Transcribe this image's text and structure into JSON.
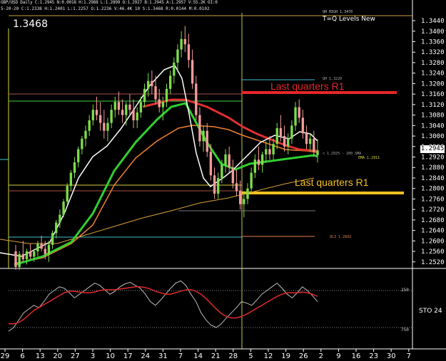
{
  "header": {
    "line1": "GBP/USD Daily  C:1.2945 N:0.0018 H:1.2988 L:1.2899 O:1.2927 B:1.2945 A:1.2957 V:55.2K OI:0",
    "line2": "5-20-20 C:1.2338 H:1.2401 L:1.2257 O:1.2236 V:46.4K 10 S:1.3468 R:0.0144 M:0.0102"
  },
  "big_price": "1.3468",
  "indicator_title": "T=Q Levels New",
  "indicator_small": "QH HIGH 1.3470",
  "level_labels": {
    "qh": "QH 1.3220",
    "ql": "QL3 1.2602",
    "sma": "< 1.2925 - 200 SMA",
    "ema": "EMA 1.2911"
  },
  "annotations": {
    "red": "Last quarters R1",
    "yellow": "Last quarters R1",
    "red_color": "#e8262b",
    "yellow_color": "#f5c022"
  },
  "current_price_tag": "1.2945",
  "price_axis": [
    "1.3440",
    "1.3400",
    "1.3360",
    "1.3320",
    "1.3280",
    "1.3240",
    "1.3200",
    "1.3160",
    "1.3120",
    "1.3080",
    "1.3040",
    "1.3000",
    "1.2960",
    "1.2920",
    "1.2880",
    "1.2840",
    "1.2800",
    "1.2760",
    "1.2720",
    "1.2680",
    "1.2640",
    "1.2600",
    "1.2560",
    "1.2520"
  ],
  "date_axis": [
    "29",
    "6",
    "13",
    "20",
    "27",
    "3",
    "10",
    "17",
    "24",
    "31",
    "7",
    "14",
    "21",
    "28",
    "5",
    "12",
    "19",
    "26",
    "2",
    "9",
    "16",
    "23",
    "30",
    "7"
  ],
  "sto": {
    "label": "STO 24",
    "upper": "250",
    "lower": "750"
  },
  "chart_data": {
    "type": "candlestick",
    "symbol": "GBP/USD",
    "timeframe": "Daily",
    "ylim": [
      1.2495,
      1.347
    ],
    "candles": [
      [
        1.256,
        1.2585,
        1.249,
        1.25
      ],
      [
        1.25,
        1.256,
        1.249,
        1.255
      ],
      [
        1.255,
        1.26,
        1.252,
        1.253
      ],
      [
        1.253,
        1.257,
        1.251,
        1.256
      ],
      [
        1.256,
        1.259,
        1.253,
        1.254
      ],
      [
        1.254,
        1.257,
        1.252,
        1.256
      ],
      [
        1.256,
        1.26,
        1.254,
        1.259
      ],
      [
        1.259,
        1.262,
        1.256,
        1.257
      ],
      [
        1.257,
        1.26,
        1.253,
        1.255
      ],
      [
        1.255,
        1.26,
        1.252,
        1.2585
      ],
      [
        1.2585,
        1.264,
        1.257,
        1.263
      ],
      [
        1.263,
        1.268,
        1.261,
        1.267
      ],
      [
        1.267,
        1.272,
        1.265,
        1.27
      ],
      [
        1.27,
        1.276,
        1.269,
        1.275
      ],
      [
        1.275,
        1.282,
        1.274,
        1.281
      ],
      [
        1.281,
        1.287,
        1.279,
        1.286
      ],
      [
        1.286,
        1.292,
        1.284,
        1.29
      ],
      [
        1.29,
        1.296,
        1.288,
        1.295
      ],
      [
        1.295,
        1.3,
        1.293,
        1.299
      ],
      [
        1.299,
        1.304,
        1.296,
        1.302
      ],
      [
        1.302,
        1.308,
        1.3,
        1.306
      ],
      [
        1.306,
        1.312,
        1.304,
        1.31
      ],
      [
        1.31,
        1.315,
        1.306,
        1.308
      ],
      [
        1.308,
        1.313,
        1.302,
        1.305
      ],
      [
        1.305,
        1.31,
        1.299,
        1.302
      ],
      [
        1.302,
        1.307,
        1.298,
        1.305
      ],
      [
        1.305,
        1.312,
        1.303,
        1.31
      ],
      [
        1.31,
        1.315,
        1.307,
        1.313
      ],
      [
        1.313,
        1.317,
        1.308,
        1.31
      ],
      [
        1.31,
        1.314,
        1.305,
        1.308
      ],
      [
        1.308,
        1.313,
        1.304,
        1.312
      ],
      [
        1.312,
        1.316,
        1.308,
        1.31
      ],
      [
        1.31,
        1.314,
        1.303,
        1.306
      ],
      [
        1.306,
        1.311,
        1.303,
        1.309
      ],
      [
        1.309,
        1.315,
        1.307,
        1.313
      ],
      [
        1.313,
        1.32,
        1.311,
        1.318
      ],
      [
        1.318,
        1.324,
        1.315,
        1.321
      ],
      [
        1.321,
        1.325,
        1.316,
        1.319
      ],
      [
        1.319,
        1.323,
        1.312,
        1.314
      ],
      [
        1.314,
        1.318,
        1.309,
        1.311
      ],
      [
        1.311,
        1.315,
        1.306,
        1.313
      ],
      [
        1.313,
        1.32,
        1.311,
        1.318
      ],
      [
        1.318,
        1.325,
        1.316,
        1.323
      ],
      [
        1.323,
        1.33,
        1.32,
        1.328
      ],
      [
        1.328,
        1.335,
        1.325,
        1.333
      ],
      [
        1.333,
        1.34,
        1.33,
        1.337
      ],
      [
        1.337,
        1.342,
        1.332,
        1.335
      ],
      [
        1.335,
        1.339,
        1.326,
        1.329
      ],
      [
        1.329,
        1.333,
        1.318,
        1.32
      ],
      [
        1.32,
        1.323,
        1.306,
        1.308
      ],
      [
        1.308,
        1.311,
        1.296,
        1.298
      ],
      [
        1.298,
        1.304,
        1.294,
        1.302
      ],
      [
        1.302,
        1.305,
        1.292,
        1.294
      ],
      [
        1.294,
        1.297,
        1.283,
        1.285
      ],
      [
        1.285,
        1.288,
        1.276,
        1.278
      ],
      [
        1.278,
        1.286,
        1.276,
        1.284
      ],
      [
        1.284,
        1.291,
        1.282,
        1.289
      ],
      [
        1.289,
        1.295,
        1.286,
        1.293
      ],
      [
        1.293,
        1.296,
        1.286,
        1.288
      ],
      [
        1.288,
        1.291,
        1.28,
        1.282
      ],
      [
        1.282,
        1.287,
        1.277,
        1.279
      ],
      [
        1.279,
        1.283,
        1.272,
        1.274
      ],
      [
        1.274,
        1.279,
        1.269,
        1.276
      ],
      [
        1.276,
        1.282,
        1.274,
        1.28
      ],
      [
        1.28,
        1.288,
        1.278,
        1.286
      ],
      [
        1.286,
        1.293,
        1.284,
        1.291
      ],
      [
        1.291,
        1.296,
        1.287,
        1.289
      ],
      [
        1.289,
        1.294,
        1.286,
        1.293
      ],
      [
        1.293,
        1.298,
        1.29,
        1.295
      ],
      [
        1.295,
        1.3,
        1.291,
        1.293
      ],
      [
        1.293,
        1.299,
        1.291,
        1.297
      ],
      [
        1.297,
        1.305,
        1.295,
        1.303
      ],
      [
        1.303,
        1.308,
        1.298,
        1.3
      ],
      [
        1.3,
        1.304,
        1.294,
        1.296
      ],
      [
        1.296,
        1.301,
        1.293,
        1.299
      ],
      [
        1.299,
        1.306,
        1.297,
        1.304
      ],
      [
        1.304,
        1.313,
        1.302,
        1.311
      ],
      [
        1.311,
        1.314,
        1.305,
        1.307
      ],
      [
        1.307,
        1.31,
        1.299,
        1.301
      ],
      [
        1.301,
        1.304,
        1.295,
        1.297
      ],
      [
        1.297,
        1.301,
        1.294,
        1.299
      ],
      [
        1.299,
        1.302,
        1.292,
        1.294
      ],
      [
        1.2927,
        1.2988,
        1.2899,
        1.2945
      ]
    ],
    "stoch_k": [
      20,
      25,
      35,
      45,
      50,
      55,
      52,
      60,
      70,
      75,
      80,
      78,
      72,
      65,
      70,
      75,
      80,
      85,
      82,
      76,
      70,
      74,
      80,
      84,
      86,
      82,
      78,
      70,
      60,
      55,
      62,
      70,
      78,
      85,
      88,
      82,
      70,
      60,
      45,
      35,
      28,
      25,
      30,
      38,
      45,
      52,
      60,
      58,
      55,
      62,
      70,
      75,
      80,
      85,
      78,
      70,
      65,
      72,
      80,
      75,
      68,
      60
    ],
    "stoch_d": [
      30,
      30,
      32,
      36,
      42,
      48,
      52,
      56,
      60,
      64,
      68,
      72,
      74,
      74,
      73,
      72,
      72,
      73,
      75,
      76,
      76,
      76,
      77,
      78,
      79,
      80,
      80,
      79,
      77,
      74,
      72,
      70,
      70,
      72,
      74,
      76,
      76,
      74,
      70,
      64,
      57,
      50,
      44,
      40,
      38,
      38,
      40,
      43,
      47,
      51,
      55,
      59,
      63,
      67,
      70,
      72,
      72,
      72,
      73,
      72,
      70,
      67
    ]
  }
}
